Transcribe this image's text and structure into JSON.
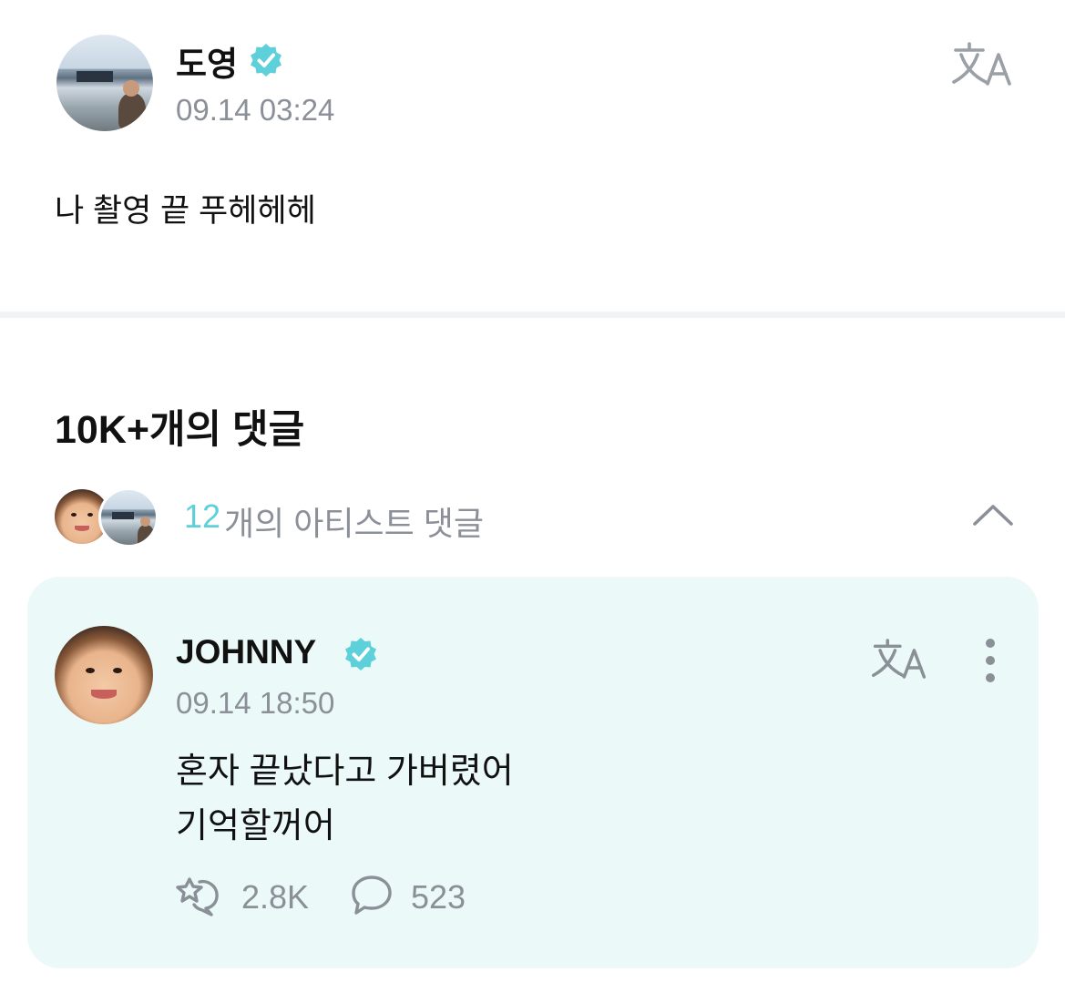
{
  "post": {
    "author_name": "도영",
    "timestamp": "09.14 03:24",
    "body": "나 촬영 끝 푸헤헤헤"
  },
  "comments_section": {
    "heading": "10K+개의 댓글",
    "artist_count": "12",
    "artist_suffix": "개의 아티스트 댓글"
  },
  "artist_comment": {
    "author_name": "JOHNNY",
    "timestamp": "09.14 18:50",
    "line1": "혼자 끝났다고 가버렸어",
    "line2": "기억할꺼어",
    "likes": "2.8K",
    "replies": "523"
  },
  "colors": {
    "accent": "#5ed0d9",
    "card_background": "#ebfaf8",
    "muted_text": "#8a8f98"
  },
  "icons": [
    "translate-icon",
    "verified-badge-icon",
    "chevron-up-icon",
    "more-options-icon",
    "bubble-like-icon",
    "comment-icon"
  ]
}
